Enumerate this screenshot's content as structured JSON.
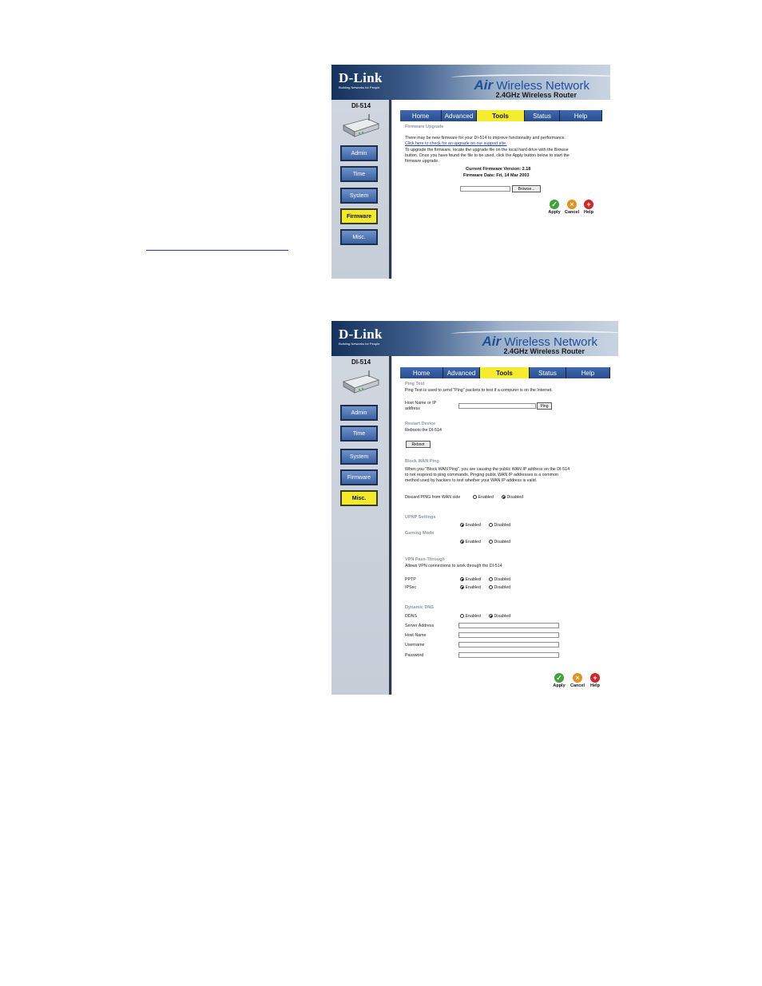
{
  "common": {
    "brand": "D-Link",
    "tagline": "Building Networks for People",
    "air_word": "Air",
    "product_title": "Wireless Network",
    "product_subtitle": "2.4GHz Wireless Router",
    "model": "DI-514",
    "tabs": [
      "Home",
      "Advanced",
      "Tools",
      "Status",
      "Help"
    ],
    "nav": [
      "Admin",
      "Time",
      "System",
      "Firmware",
      "Misc."
    ],
    "actions": {
      "apply": "Apply",
      "cancel": "Cancel",
      "help": "Help"
    }
  },
  "firmware_page": {
    "active_tab": "Tools",
    "active_nav": "Firmware",
    "section_title": "Firmware Upgrade",
    "line1": "There may be new firmware for your DI-514 to improve functionality and performance.",
    "link_text": "Click here to check for an upgrade on our support site.",
    "line3": "To upgrade the firmware, locate the upgrade file on the local hard drive with the Browse",
    "line4": "button. Once you have found the file to be used, click the Apply button below to start the",
    "line5": "firmware upgrade.",
    "current_version": "Current Firmware Version: 2.18",
    "firmware_date": "Firmware Date: Fri, 14 Mar 2003",
    "browse_label": "Browse..."
  },
  "misc_page": {
    "active_tab": "Tools",
    "active_nav": "Misc.",
    "ping": {
      "title": "Ping Test",
      "desc": "Ping Test is used to send \"Ping\" packets to test if a computer is on the Internet.",
      "host_label_1": "Host Name or IP",
      "host_label_2": "address",
      "button": "Ping"
    },
    "reboot": {
      "title": "Restart Device",
      "desc": "Reboots the DI-514",
      "button": "Reboot"
    },
    "block_wan": {
      "title": "Block WAN Ping",
      "line1": "When you \"Block WAN Ping\", you are causing the public WAN IP address on the DI-514",
      "line2": "to not respond to ping commands. Pinging public WAN IP addresses is a common",
      "line3": "method used by hackers to test whether your WAN IP address is valid.",
      "discard_label": "Discard PING from WAN side",
      "selected": "Disabled"
    },
    "upnp": {
      "title": "UPNP Settings",
      "selected": "Enabled"
    },
    "gaming": {
      "title": "Gaming Mode",
      "selected": "Enabled"
    },
    "vpn": {
      "title": "VPN Pass-Through",
      "desc": "Allows VPN connections to work through the DI-514",
      "pptp_label": "PPTP",
      "pptp_selected": "Enabled",
      "ipsec_label": "IPSec",
      "ipsec_selected": "Enabled"
    },
    "ddns": {
      "title": "Dynamic DNS",
      "ddns_label": "DDNS",
      "selected": "Disabled",
      "server_label": "Server Address",
      "host_label": "Host Name",
      "user_label": "Username",
      "pass_label": "Password",
      "server_value": "",
      "host_value": "",
      "user_value": "",
      "pass_value": ""
    },
    "enabled_text": "Enabled",
    "disabled_text": "Disabled"
  },
  "colors": {
    "tab_active": "#f4ec2c",
    "nav_active": "#f2ea2a",
    "nav_inactive": "#3b62a3",
    "link": "#1f3fa0",
    "section_title": "#8c96a3"
  }
}
